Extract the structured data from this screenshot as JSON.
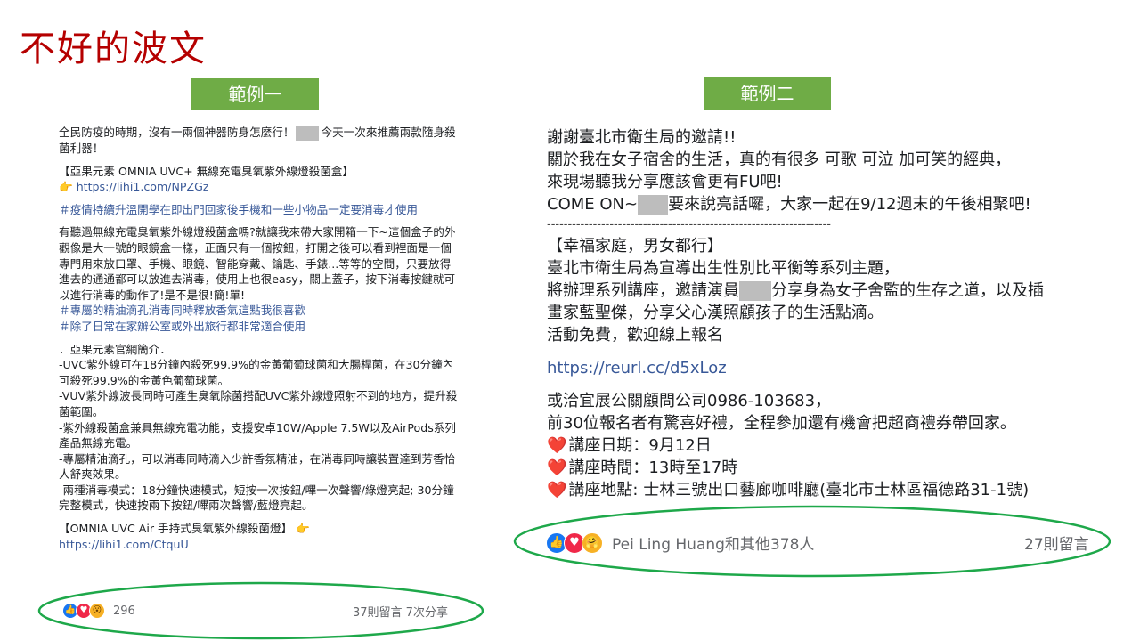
{
  "slide_title": "不好的波文",
  "tags": {
    "example1": "範例一",
    "example2": "範例二"
  },
  "post1": {
    "intro_a": "全民防疫的時期，沒有一兩個神器防身怎麼行！",
    "intro_b": "今天一次來推薦兩款隨身殺菌利器！",
    "product_title": "【亞果元素 OMNIA UVC+ 無線充電臭氧紫外線燈殺菌盒】",
    "pointer_emoji": "👉",
    "link1": "https://lihi1.com/NPZGz",
    "hashtag1": "＃疫情持續升溫開學在即出門回家後手機和一些小物品一定要消毒才使用",
    "body": "有聽過無線充電臭氧紫外線燈殺菌盒嗎?就讓我來帶大家開箱一下~這個盒子的外觀像是大一號的眼鏡盒一樣，正面只有一個按鈕，打開之後可以看到裡面是一個專門用來放口罩、手機、眼鏡、智能穿戴、鑰匙、手錶...等等的空間，只要放得進去的通通都可以放進去消毒，使用上也很easy，關上蓋子，按下消毒按鍵就可以進行消毒的動作了!是不是很!簡!單!",
    "hashtag2": "＃專屬的精油滴孔消毒同時釋放香氣這點我很喜歡",
    "hashtag3": "＃除了日常在家辦公室或外出旅行都非常適合使用",
    "official_intro": "．亞果元素官網簡介．",
    "bullets": [
      " -UVC紫外線可在18分鐘內殺死99.9%的金黃葡萄球菌和大腸桿菌，在30分鐘內可殺死99.9%的金黃色葡萄球菌。",
      "-VUV紫外線波長同時可產生臭氧除菌搭配UVC紫外線燈照射不到的地方，提升殺菌範圍。",
      "-紫外線殺菌盒兼具無線充電功能，支援安卓10W/Apple 7.5W以及AirPods系列產品無線充電。",
      "-專屬精油滴孔，可以消毒同時滴入少許香氛精油，在消毒同時讓裝置達到芳香怡人舒爽效果。",
      "-兩種消毒模式：18分鐘快速模式，短按一次按鈕/嗶一次聲響/綠燈亮起; 30分鐘完整模式，快速按兩下按鈕/嗶兩次聲響/藍燈亮起。"
    ],
    "product2_title": " 【OMNIA UVC Air 手持式臭氧紫外線殺菌燈】 ",
    "link2": "https://lihi1.com/CtquU",
    "reaction_count": "296",
    "meta": "37則留言  7次分享"
  },
  "post2": {
    "line1": "謝謝臺北市衛生局的邀請!!",
    "line2": "關於我在女子宿舍的生活，真的有很多 可歌 可泣 加可笑的經典，",
    "line3": "來現場聽我分享應該會更有FU吧!",
    "line4a": "COME ON~",
    "line4b": "要來說亮話囉，大家一起在9/12週末的午後相聚吧!",
    "divider": "--------------------------------------------------------------------",
    "heading": "【幸福家庭，男女都行】",
    "line5": "臺北市衛生局為宣導出生性別比平衡等系列主題，",
    "line6a": "將辦理系列講座，邀請演員",
    "line6b": "分享身為女子舍監的生存之道，以及插",
    "line7": "畫家藍聖傑，分享父心漢照顧孩子的生活點滴。",
    "line8": "活動免費，歡迎線上報名",
    "link": "https://reurl.cc/d5xLoz",
    "line9": "或洽宜展公關顧問公司0986-103683，",
    "line10": "前30位報名者有驚喜好禮，全程參加還有機會把超商禮券帶回家。",
    "heart_emoji": "❤️",
    "date": "講座日期：9月12日",
    "time": "講座時間：13時至17時",
    "place": "講座地點: 士林三號出口藝廊咖啡廳(臺北市士林區福德路31-1號)",
    "reaction_text": "Pei Ling Huang和其他378人",
    "meta": "27則留言"
  },
  "colors": {
    "title_red": "#b50000",
    "tag_green": "#6fac46",
    "ellipse_green": "#1ea84a",
    "link_blue": "#385898",
    "facebook_blue": "#1877f2"
  }
}
